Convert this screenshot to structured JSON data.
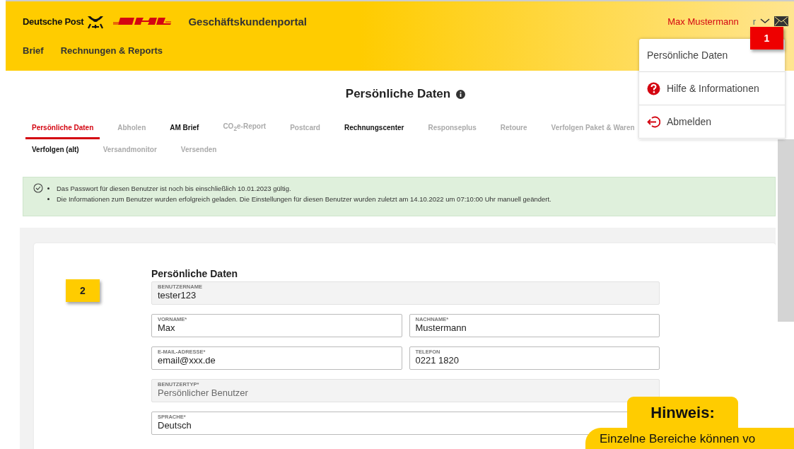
{
  "header": {
    "brand": "Deutsche Post",
    "portal_title": "Geschäftskundenportal",
    "nav": [
      {
        "label": "Brief"
      },
      {
        "label": "Rechnungen & Reports"
      }
    ],
    "user_name": "Max Mustermann",
    "user_suffix": "r"
  },
  "user_menu": {
    "items": [
      {
        "label": "Persönliche Daten",
        "kind": "plain"
      },
      {
        "label": "Hilfe & Informationen",
        "kind": "help"
      },
      {
        "label": "Abmelden",
        "kind": "logout"
      }
    ]
  },
  "page_title": "Persönliche Daten",
  "tabs": [
    [
      {
        "label": "Persönliche Daten",
        "selected": true,
        "disabled": false
      },
      {
        "label": "Abholen",
        "selected": false,
        "disabled": true
      },
      {
        "label": "AM Brief",
        "selected": false,
        "disabled": false
      },
      {
        "label": "CO$_{2}$e-Report",
        "selected": false,
        "disabled": true
      },
      {
        "label": "Postcard",
        "selected": false,
        "disabled": true
      },
      {
        "label": "Rechnungscenter",
        "selected": false,
        "disabled": false
      },
      {
        "label": "Responseplus",
        "selected": false,
        "disabled": true
      },
      {
        "label": "Retoure",
        "selected": false,
        "disabled": true
      },
      {
        "label": "Verfolgen Paket & Waren",
        "selected": false,
        "disabled": true
      }
    ],
    [
      {
        "label": "Verfolgen (alt)",
        "selected": false,
        "disabled": false
      },
      {
        "label": "Versandmonitor",
        "selected": false,
        "disabled": true
      },
      {
        "label": "Versenden",
        "selected": false,
        "disabled": true
      }
    ]
  ],
  "alert": {
    "messages": [
      "Das Passwort für diesen Benutzer ist noch bis einschließlich 10.01.2023 gültig.",
      "Die Informationen zum Benutzer wurden erfolgreich geladen. Die Einstellungen für diesen Benutzer wurden zuletzt am 14.10.2022 um 07:10:00 Uhr manuell geändert."
    ]
  },
  "form": {
    "section_title": "Persönliche Daten",
    "rows": [
      [
        {
          "label": "BENUTZERNAME",
          "value": "tester123",
          "disabled": true
        }
      ],
      [
        {
          "label": "VORNAME*",
          "value": "Max",
          "disabled": false
        },
        {
          "label": "NACHNAME*",
          "value": "Mustermann",
          "disabled": false
        }
      ],
      [
        {
          "label": "E-MAIL-ADRESSE*",
          "value": "email@xxx.de",
          "disabled": false
        },
        {
          "label": "TELEFON",
          "value": "0221 1820",
          "disabled": false
        }
      ],
      [
        {
          "label": "BENUTZERTYP*",
          "value": "Persönlicher Benutzer",
          "disabled": true
        }
      ],
      [
        {
          "label": "SPRACHE*",
          "value": "Deutsch",
          "disabled": false
        }
      ]
    ]
  },
  "annotations": [
    {
      "label": "1",
      "color": "#ee0000"
    },
    {
      "label": "2",
      "color": "#ffcc00"
    }
  ],
  "hint": {
    "title": "Hinweis:",
    "text": "Einzelne Bereiche können vo"
  }
}
